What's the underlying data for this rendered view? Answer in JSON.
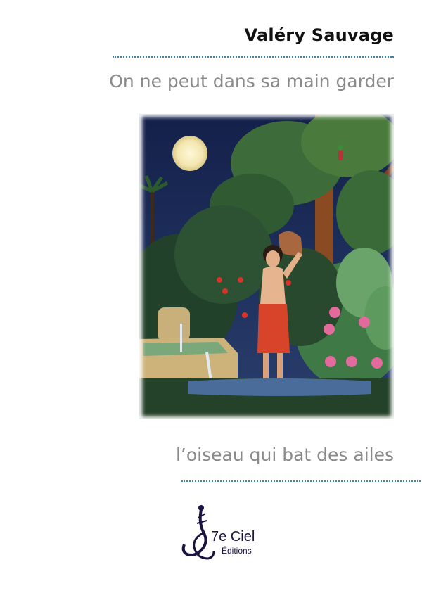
{
  "cover": {
    "author": "Valéry Sauvage",
    "title_line1": "On ne peut dans sa main garder",
    "title_line2": "l’oiseau qui bat des ailes"
  },
  "publisher": {
    "name": "7e Ciel",
    "imprint": "Éditions"
  },
  "colors": {
    "rule": "#3b84b6",
    "title_text": "#8a8a8a",
    "author_text": "#111111",
    "logo": "#1a1340"
  }
}
